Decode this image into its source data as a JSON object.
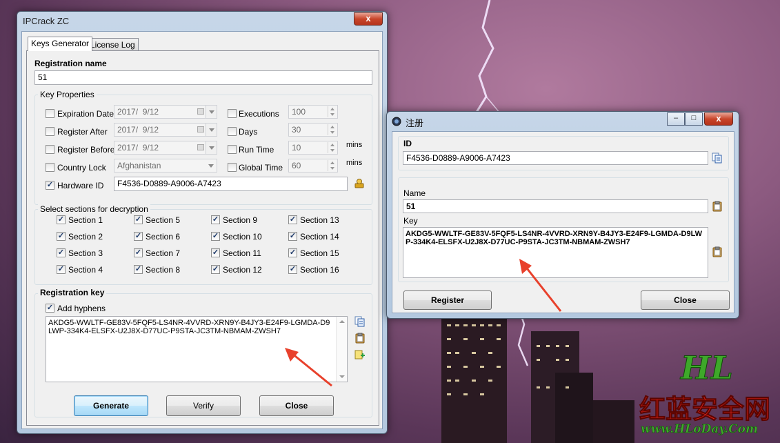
{
  "main_window": {
    "title": "IPCrack ZC",
    "close_glyph": "x",
    "tabs": [
      {
        "label": "Keys Generator",
        "active": true
      },
      {
        "label": "License Log",
        "active": false
      }
    ],
    "registration_name_label": "Registration name",
    "registration_name_value": "51",
    "key_properties": {
      "group_label": "Key Properties",
      "expiration_date": {
        "label": "Expiration Date",
        "checked": false,
        "value": "2017/  9/12"
      },
      "register_after": {
        "label": "Register After",
        "checked": false,
        "value": "2017/  9/12"
      },
      "register_before": {
        "label": "Register Before",
        "checked": false,
        "value": "2017/  9/12"
      },
      "country_lock": {
        "label": "Country Lock",
        "checked": false,
        "value": "Afghanistan"
      },
      "hardware_id": {
        "label": "Hardware ID",
        "checked": true,
        "value": "F4536-D0889-A9006-A7423"
      },
      "executions": {
        "label": "Executions",
        "checked": false,
        "value": "100"
      },
      "days": {
        "label": "Days",
        "checked": false,
        "value": "30"
      },
      "run_time": {
        "label": "Run Time",
        "checked": false,
        "value": "10",
        "unit": "mins"
      },
      "global_time": {
        "label": "Global Time",
        "checked": false,
        "value": "60",
        "unit": "mins"
      }
    },
    "sections": {
      "group_label": "Select sections for decryption",
      "items": [
        "Section 1",
        "Section 5",
        "Section 9",
        "Section 13",
        "Section 2",
        "Section 6",
        "Section 10",
        "Section 14",
        "Section 3",
        "Section 7",
        "Section 11",
        "Section 15",
        "Section 4",
        "Section 8",
        "Section 12",
        "Section 16"
      ]
    },
    "registration_key": {
      "group_label": "Registration key",
      "add_hyphens_label": "Add hyphens",
      "add_hyphens_checked": true,
      "value": "AKDG5-WWLTF-GE83V-5FQF5-LS4NR-4VVRD-XRN9Y-B4JY3-E24F9-LGMDA-D9LWP-334K4-ELSFX-U2J8X-D77UC-P9STA-JC3TM-NBMAM-ZWSH7"
    },
    "buttons": {
      "generate": "Generate",
      "verify": "Verify",
      "close": "Close"
    },
    "check_glyph": "✓"
  },
  "register_window": {
    "title": "注册",
    "min_glyph": "–",
    "max_glyph": "□",
    "close_glyph": "x",
    "id_label": "ID",
    "id_value": "F4536-D0889-A9006-A7423",
    "name_label": "Name",
    "name_value": "51",
    "key_label": "Key",
    "key_value": "AKDG5-WWLTF-GE83V-5FQF5-LS4NR-4VVRD-XRN9Y-B4JY3-E24F9-LGMDA-D9LWP-334K4-ELSFX-U2J8X-D77UC-P9STA-JC3TM-NBMAM-ZWSH7",
    "buttons": {
      "register": "Register",
      "close": "Close"
    }
  },
  "watermark": {
    "logo": "HL",
    "cn_text": "红蓝安全网",
    "url": "www.HLoDay.Com"
  },
  "colors": {
    "accent_arrow": "#e8412c",
    "watermark_green": "#3ea82a",
    "watermark_red": "#e2231a"
  }
}
